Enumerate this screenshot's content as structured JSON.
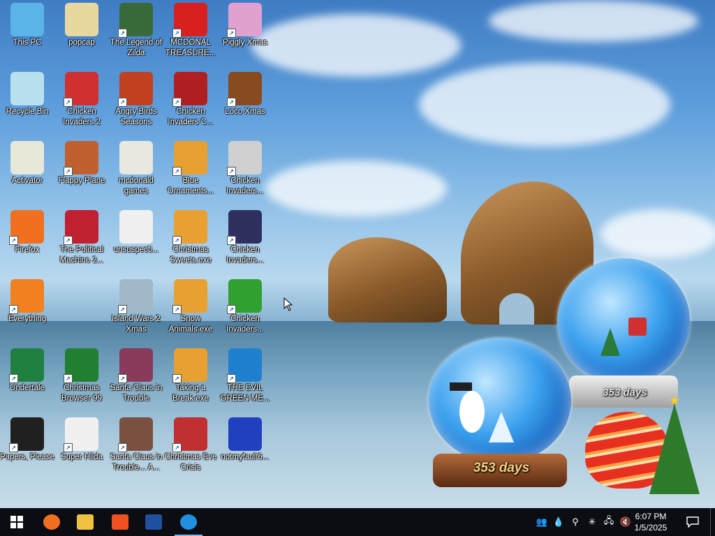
{
  "desktop_icons": [
    {
      "label": "This PC",
      "icon": "computer-icon",
      "shortcut": false,
      "color": "#5ab4e8"
    },
    {
      "label": "popcap",
      "icon": "folder-icon",
      "shortcut": false,
      "color": "#e8d8a0"
    },
    {
      "label": "The Legend of Zilda",
      "icon": "game-icon",
      "shortcut": true,
      "color": "#3a6a3a"
    },
    {
      "label": "MCDONAL TREASURE...",
      "icon": "mcdonalds-icon",
      "shortcut": true,
      "color": "#d82020"
    },
    {
      "label": "Piggly Xmas",
      "icon": "pig-icon",
      "shortcut": true,
      "color": "#e0a0d0"
    },
    {
      "label": "Recycle Bin",
      "icon": "recycle-bin-icon",
      "shortcut": false,
      "color": "#b8e0ee"
    },
    {
      "label": "Chicken Invaders 2",
      "icon": "chicken-icon",
      "shortcut": true,
      "color": "#d03030"
    },
    {
      "label": "Angry Birds Seasons",
      "icon": "angry-birds-icon",
      "shortcut": true,
      "color": "#c04020"
    },
    {
      "label": "Chicken Invaders C...",
      "icon": "chicken-icon",
      "shortcut": true,
      "color": "#b02020"
    },
    {
      "label": "Loco Xmas",
      "icon": "bear-icon",
      "shortcut": true,
      "color": "#8a4a20"
    },
    {
      "label": "Activator",
      "icon": "folder-icon",
      "shortcut": false,
      "color": "#e8e8d8"
    },
    {
      "label": "Flappy Plane",
      "icon": "game-icon",
      "shortcut": true,
      "color": "#c06030"
    },
    {
      "label": "mcdonald games",
      "icon": "folder-icon",
      "shortcut": false,
      "color": "#e8e8e0"
    },
    {
      "label": "Blue Ornaments...",
      "icon": "installer-icon",
      "shortcut": true,
      "color": "#e8a030"
    },
    {
      "label": "Chicken Invaders...",
      "icon": "chicken-icon",
      "shortcut": true,
      "color": "#d0d0d0"
    },
    {
      "label": "Firefox",
      "icon": "firefox-icon",
      "shortcut": true,
      "color": "#f07020"
    },
    {
      "label": "The Political Machine 2...",
      "icon": "political-icon",
      "shortcut": true,
      "color": "#c02030"
    },
    {
      "label": "unsuspecti...",
      "icon": "folder-icon",
      "shortcut": false,
      "color": "#f0f0f0"
    },
    {
      "label": "Christmas Sweets.exe",
      "icon": "installer-icon",
      "shortcut": true,
      "color": "#e8a030"
    },
    {
      "label": "Chicken Invaders...",
      "icon": "chicken-icon",
      "shortcut": true,
      "color": "#303060"
    },
    {
      "label": "Everything",
      "icon": "search-icon",
      "shortcut": true,
      "color": "#f08020"
    },
    {
      "label": "Island Wars 2 Xmas",
      "icon": "game-icon",
      "shortcut": true,
      "color": "#a0b8c8"
    },
    {
      "label": "Snow Animals.exe",
      "icon": "installer-icon",
      "shortcut": true,
      "color": "#e8a030"
    },
    {
      "label": "Chicken Invaders...",
      "icon": "chicken-icon",
      "shortcut": true,
      "color": "#30a030"
    },
    {
      "label": "Undertale",
      "icon": "undertale-icon",
      "shortcut": true,
      "color": "#208040"
    },
    {
      "label": "Christmas Browser 99",
      "icon": "tree-icon",
      "shortcut": true,
      "color": "#208030"
    },
    {
      "label": "Santa Claus in Trouble",
      "icon": "santa-icon",
      "shortcut": true,
      "color": "#8a3a5a"
    },
    {
      "label": "Taking a Break.exe",
      "icon": "installer-icon",
      "shortcut": true,
      "color": "#e8a030"
    },
    {
      "label": "THE EVIL GREEN ME...",
      "icon": "messenger-icon",
      "shortcut": true,
      "color": "#2080d0"
    },
    {
      "label": "Papers, Please",
      "icon": "papers-icon",
      "shortcut": true,
      "color": "#202020"
    },
    {
      "label": "Super Hilda",
      "icon": "game-icon",
      "shortcut": true,
      "color": "#f0f0f0"
    },
    {
      "label": "Santa Claus in Trouble... A...",
      "icon": "santa-icon",
      "shortcut": true,
      "color": "#7a5040"
    },
    {
      "label": "Christmas Eve Crisis",
      "icon": "santa-icon",
      "shortcut": true,
      "color": "#c03030"
    },
    {
      "label": "notmyfault6...",
      "icon": "bsod-icon",
      "shortcut": false,
      "color": "#2040c0"
    }
  ],
  "snow_globes": [
    {
      "label": "353 days"
    },
    {
      "label": "353 days"
    }
  ],
  "taskbar": {
    "start_icon": "windows-start-icon",
    "pinned": [
      {
        "icon": "firefox-icon",
        "color": "#f07020"
      },
      {
        "icon": "file-explorer-icon",
        "color": "#f0c040"
      },
      {
        "icon": "brave-icon",
        "color": "#f05020"
      },
      {
        "icon": "window-app-icon",
        "color": "#2050a0"
      },
      {
        "icon": "messenger-icon",
        "color": "#2090e0"
      }
    ],
    "tray_icons": [
      "people-icon",
      "water-drop-icon",
      "search-icon",
      "snowflake-icon",
      "network-icon",
      "volume-muted-icon"
    ],
    "time": "6:07 PM",
    "date": "1/5/2025",
    "notification_icon": "notification-icon"
  }
}
